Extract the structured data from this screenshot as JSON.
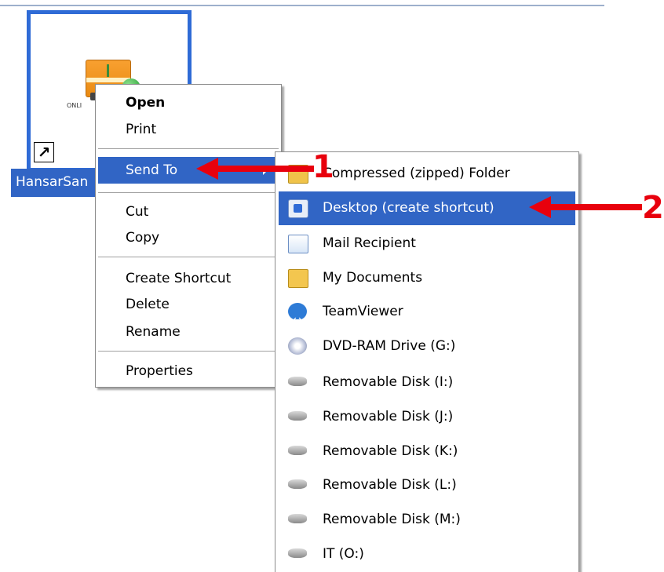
{
  "desktop_icon": {
    "label": "HansarSan",
    "sublabel": "ONLI",
    "icon": "app-icon"
  },
  "context_menu": {
    "items": [
      {
        "label": "Open"
      },
      {
        "label": "Print"
      },
      {
        "label": "Send To"
      },
      {
        "label": "Cut"
      },
      {
        "label": "Copy"
      },
      {
        "label": "Create Shortcut"
      },
      {
        "label": "Delete"
      },
      {
        "label": "Rename"
      },
      {
        "label": "Properties"
      }
    ],
    "selected": "Send To"
  },
  "send_to_menu": {
    "items": [
      {
        "label": "Compressed (zipped) Folder",
        "icon": "zip-folder-icon"
      },
      {
        "label": "Desktop (create shortcut)",
        "icon": "desktop-icon"
      },
      {
        "label": "Mail Recipient",
        "icon": "mail-icon"
      },
      {
        "label": "My Documents",
        "icon": "documents-icon"
      },
      {
        "label": "TeamViewer",
        "icon": "teamviewer-icon"
      },
      {
        "label": "DVD-RAM Drive (G:)",
        "icon": "dvd-drive-icon"
      },
      {
        "label": "Removable Disk (I:)",
        "icon": "removable-disk-icon"
      },
      {
        "label": "Removable Disk (J:)",
        "icon": "removable-disk-icon"
      },
      {
        "label": "Removable Disk (K:)",
        "icon": "removable-disk-icon"
      },
      {
        "label": "Removable Disk (L:)",
        "icon": "removable-disk-icon"
      },
      {
        "label": "Removable Disk (M:)",
        "icon": "removable-disk-icon"
      },
      {
        "label": "IT (O:)",
        "icon": "removable-disk-icon"
      }
    ],
    "selected": "Desktop (create shortcut)"
  },
  "annotations": {
    "step1": "1",
    "step2": "2",
    "color": "#e8000d"
  },
  "colors": {
    "highlight": "#3165c5",
    "icon_border": "#2f6bd6"
  }
}
